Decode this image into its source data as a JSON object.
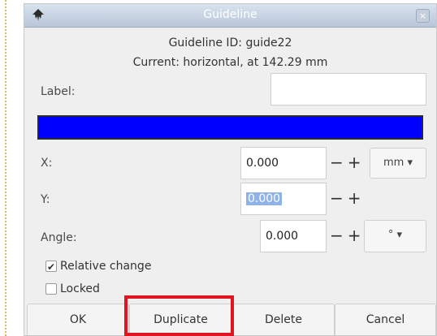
{
  "window": {
    "title": "Guideline",
    "close_glyph": "×",
    "icon": "inkscape-app-icon"
  },
  "info": {
    "guide_id": "Guideline ID: guide22",
    "current": "Current: horizontal, at 142.29 mm"
  },
  "label_field": {
    "label": "Label:",
    "value": ""
  },
  "guide_color": "#0000ff",
  "x_field": {
    "label": "X:",
    "value": "0.000",
    "minus": "−",
    "plus": "+",
    "unit": "mm ▾"
  },
  "y_field": {
    "label": "Y:",
    "value": "0.000",
    "minus": "−",
    "plus": "+"
  },
  "angle_field": {
    "label": "Angle:",
    "value": "0.000",
    "minus": "−",
    "plus": "+",
    "unit": "°   ▾"
  },
  "relative_change": {
    "label": "Relative change",
    "checked": true,
    "check_glyph": "✔"
  },
  "locked": {
    "label": "Locked",
    "checked": false
  },
  "buttons": {
    "ok": "OK",
    "duplicate": "Duplicate",
    "delete": "Delete",
    "cancel": "Cancel"
  },
  "colors": {
    "highlight": "#e0151f",
    "selection": "#8fb3e8"
  }
}
